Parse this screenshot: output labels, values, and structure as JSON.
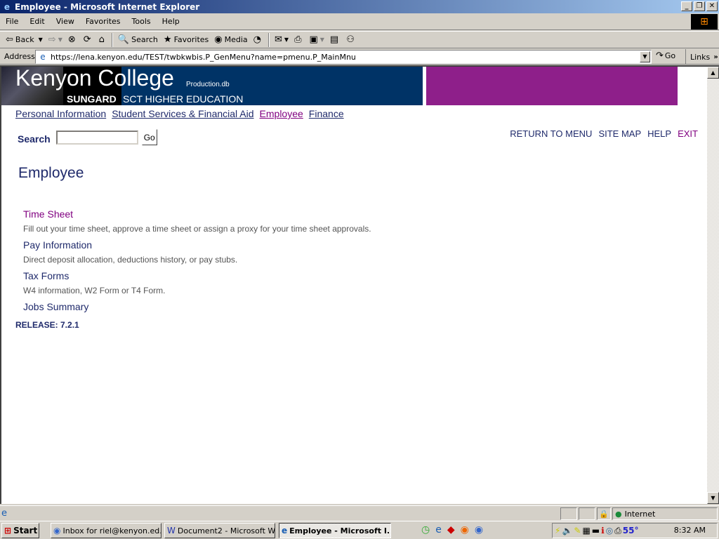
{
  "window": {
    "title": "Employee - Microsoft Internet Explorer",
    "controls": [
      "minimize",
      "restore",
      "close"
    ]
  },
  "menubar": [
    "File",
    "Edit",
    "View",
    "Favorites",
    "Tools",
    "Help"
  ],
  "toolbar": {
    "back": "Back",
    "search": "Search",
    "favorites": "Favorites",
    "media": "Media"
  },
  "address": {
    "label": "Address",
    "url": "https://lena.kenyon.edu/TEST/twbkwbis.P_GenMenu?name=pmenu.P_MainMnu",
    "go": "Go",
    "links": "Links"
  },
  "banner": {
    "college": "Kenyon College",
    "db": "Production.db",
    "sungard": "SUNGARD",
    "sct": "SCT HIGHER EDUCATION",
    "purple": "#8e1f8a",
    "navy": "#003366"
  },
  "nav": {
    "tabs": [
      {
        "label": "Personal Information"
      },
      {
        "label": "Student Services & Financial Aid"
      },
      {
        "label": "Employee"
      },
      {
        "label": "Finance"
      }
    ]
  },
  "search": {
    "label": "Search",
    "value": "",
    "button": "Go"
  },
  "toplinks": [
    "RETURN TO MENU",
    "SITE MAP",
    "HELP",
    "EXIT"
  ],
  "page": {
    "title": "Employee",
    "items": [
      {
        "label": "Time Sheet",
        "desc": "Fill out your time sheet, approve a time sheet or assign a proxy for your time sheet approvals."
      },
      {
        "label": "Pay Information",
        "desc": "Direct deposit allocation, deductions history, or pay stubs."
      },
      {
        "label": "Tax Forms",
        "desc": "W4 information, W2 Form or T4 Form."
      },
      {
        "label": "Jobs Summary",
        "desc": ""
      }
    ],
    "release": "RELEASE: 7.2.1"
  },
  "statusbar": {
    "zone": "Internet"
  },
  "taskbar": {
    "start": "Start",
    "buttons": [
      "Inbox for riel@kenyon.ed...",
      "Document2 - Microsoft W...",
      "Employee - Microsoft I..."
    ],
    "temp": "55°",
    "clock": "8:32 AM"
  }
}
